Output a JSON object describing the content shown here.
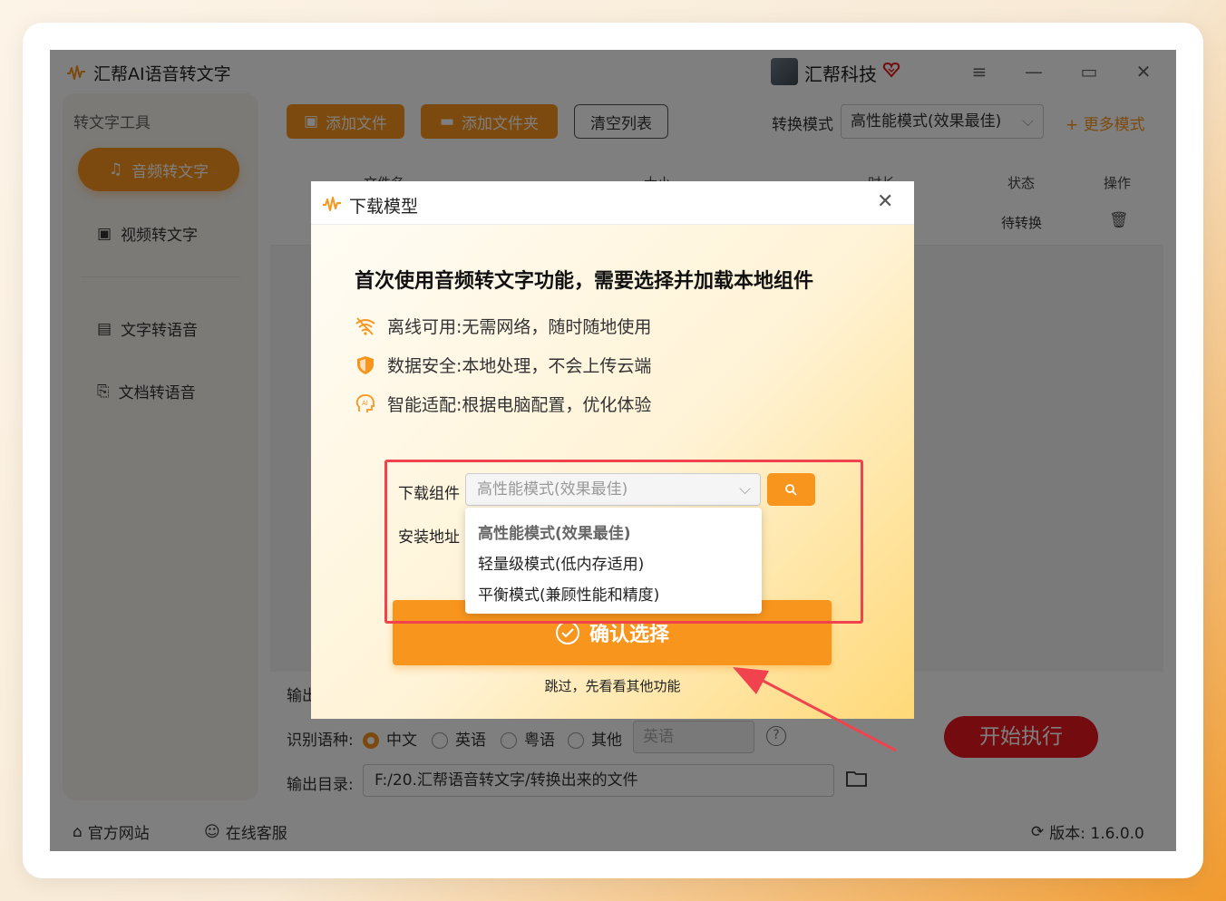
{
  "app": {
    "title": "汇帮AI语音转文字",
    "company": "汇帮科技"
  },
  "window_controls": [
    "≡",
    "—",
    "▭",
    "✕"
  ],
  "sidebar": {
    "header": "转文字工具",
    "items": [
      {
        "label": "音频转文字",
        "active": true
      },
      {
        "label": "视频转文字",
        "active": false
      },
      {
        "label": "文字转语音",
        "active": false
      },
      {
        "label": "文档转语音",
        "active": false
      }
    ]
  },
  "toolbar": {
    "add_file": "添加文件",
    "add_folder": "添加文件夹",
    "clear_list": "清空列表",
    "mode_label": "转换模式",
    "mode_value": "高性能模式(效果最佳)",
    "more_modes": "+ 更多模式"
  },
  "table": {
    "columns": [
      "文件名",
      "大小",
      "时长",
      "状态",
      "操作"
    ],
    "rows": [
      {
        "status": "待转换"
      }
    ]
  },
  "bottom": {
    "output_label": "输出",
    "lang_label": "识别语种:",
    "languages": [
      {
        "label": "中文",
        "selected": true
      },
      {
        "label": "英语",
        "selected": false
      },
      {
        "label": "粤语",
        "selected": false
      },
      {
        "label": "其他",
        "selected": false
      }
    ],
    "lang_select": "英语",
    "dir_label": "输出目录:",
    "dir_value": "F:/20.汇帮语音转文字/转换出来的文件",
    "start": "开始执行"
  },
  "footer": {
    "website": "官方网站",
    "service": "在线客服",
    "version": "版本: 1.6.0.0"
  },
  "modal": {
    "title": "下载模型",
    "heading": "首次使用音频转文字功能，需要选择并加载本地组件",
    "features": [
      {
        "icon": "wifi-icon",
        "text": "离线可用:无需网络，随时随地使用"
      },
      {
        "icon": "shield-icon",
        "text": "数据安全:本地处理，不会上传云端"
      },
      {
        "icon": "ai-icon",
        "text": "智能适配:根据电脑配置，优化体验"
      }
    ],
    "download_label": "下载组件",
    "download_value": "高性能模式(效果最佳)",
    "install_label": "安装地址",
    "options": [
      "高性能模式(效果最佳)",
      "轻量级模式(低内存适用)",
      "平衡模式(兼顾性能和精度)"
    ],
    "confirm": "确认选择",
    "skip": "跳过，先看看其他功能"
  },
  "colors": {
    "accent": "#f8951d",
    "danger": "#e8161d",
    "highlight": "#f0434d"
  }
}
